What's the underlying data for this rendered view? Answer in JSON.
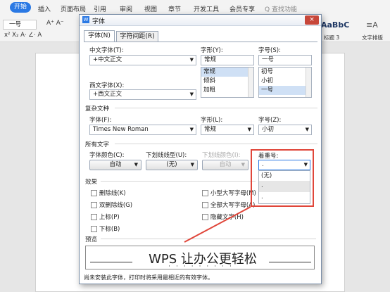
{
  "ribbon": {
    "menus": [
      "开始",
      "插入",
      "页面布局",
      "引用",
      "审阅",
      "视图",
      "章节",
      "开发工具",
      "会员专享"
    ],
    "search": "Q 查找功能",
    "font_size_box": "一号",
    "style_sample": "AaBbC",
    "style_name": "标题 3",
    "arrange_label": "文字排版"
  },
  "dialog": {
    "title": "字体",
    "close": "×",
    "tabs": [
      "字体(N)",
      "字符间距(R)"
    ],
    "chinese_font_label": "中文字体(T):",
    "chinese_font_value": "+中文正文",
    "style_label": "字形(Y):",
    "style_value": "常规",
    "style_options": [
      "常规",
      "倾斜",
      "加粗"
    ],
    "size_label": "字号(S):",
    "size_value": "一号",
    "size_options": [
      "初号",
      "小初",
      "一号"
    ],
    "western_font_label": "西文字体(X):",
    "western_font_value": "+西文正文",
    "complex_group": "复杂文种",
    "complex_font_label": "字体(F):",
    "complex_font_value": "Times New Roman",
    "complex_style_label": "字形(L):",
    "complex_style_value": "常规",
    "complex_size_label": "字号(Z):",
    "complex_size_value": "小初",
    "all_text_group": "所有文字",
    "color_label": "字体颜色(C):",
    "color_value": "自动",
    "underline_label": "下划线线型(U):",
    "underline_value": "(无)",
    "underline_color_label": "下划线颜色(I):",
    "underline_color_value": "自动",
    "emphasis_label": "着重号:",
    "emphasis_value": ".",
    "emphasis_options": [
      "(无)",
      ".",
      " ."
    ],
    "effects_group": "效果",
    "effects_left": [
      "删除线(K)",
      "双删除线(G)",
      "上标(P)",
      "下标(B)"
    ],
    "effects_right": [
      "小型大写字母(M)",
      "全部大写字母(A)",
      "隐藏文字(H)"
    ],
    "preview_group": "预览",
    "preview_text": "WPS 让办公更轻松",
    "footnote": "尚未安装此字体，打印时将采用最相近的有效字体。"
  },
  "colors": {
    "accent": "#2b79e4",
    "highlight": "#e0463a"
  }
}
